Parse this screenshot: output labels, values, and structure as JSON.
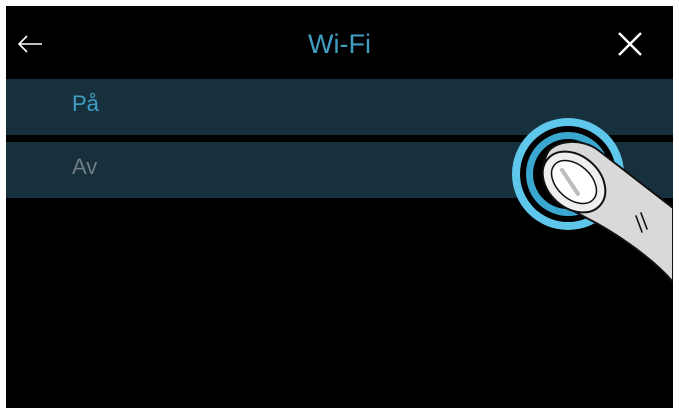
{
  "header": {
    "title": "Wi-Fi",
    "back_icon": "arrow-left-icon",
    "close_icon": "close-icon"
  },
  "options": [
    {
      "label": "På",
      "state": "default"
    },
    {
      "label": "Av",
      "state": "highlighted-touch"
    }
  ],
  "colors": {
    "background": "#000000",
    "row": "#17303e",
    "accent": "#3f9fc2",
    "muted_text": "#6e7c84",
    "icon": "#ffffff"
  },
  "illustration": "finger-tap-icon"
}
